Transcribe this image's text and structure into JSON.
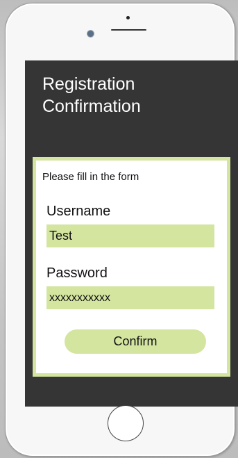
{
  "screen": {
    "title": "Registration\nConfirmation"
  },
  "form": {
    "hint": "Please fill in the form",
    "username_label": "Username",
    "username_value": "Test",
    "password_label": "Password",
    "password_value": "xxxxxxxxxxx",
    "confirm_label": "Confirm"
  },
  "colors": {
    "screen_background": "#353535",
    "accent": "#d4e5a0",
    "phone_body": "#f7f7f7"
  },
  "icons": {
    "camera": "camera-icon",
    "home": "home-button-icon"
  }
}
